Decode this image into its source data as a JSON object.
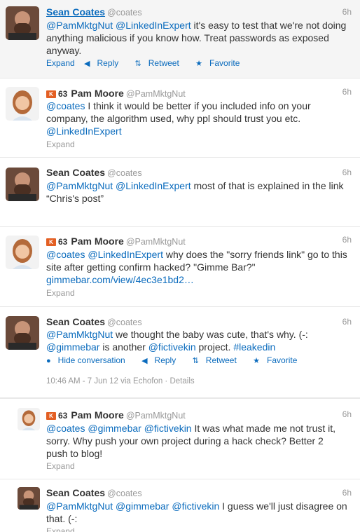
{
  "tweets": [
    {
      "name": "Sean Coates",
      "handle": "@coates",
      "time": "6h",
      "text_parts": [
        {
          "t": "@PamMktgNut",
          "m": true
        },
        {
          "t": " ",
          "m": false
        },
        {
          "t": "@LinkedInExpert",
          "m": true
        },
        {
          "t": " it's easy to test that we're not doing anything malicious if you know how. Treat passwords as exposed anyway.",
          "m": false
        }
      ],
      "actions": {
        "expand": "Expand",
        "reply": "Reply",
        "retweet": "Retweet",
        "favorite": "Favorite"
      }
    },
    {
      "name": "Pam Moore",
      "handle": "@PamMktgNut",
      "klout": "63",
      "time": "6h",
      "text_parts": [
        {
          "t": "@coates",
          "m": true
        },
        {
          "t": " I think it would be better if you included info on your company, the algorithm used, why ppl should trust you etc. ",
          "m": false
        },
        {
          "t": "@LinkedInExpert",
          "m": true
        }
      ],
      "expand": "Expand"
    },
    {
      "name": "Sean Coates",
      "handle": "@coates",
      "time": "6h",
      "text_parts": [
        {
          "t": "@PamMktgNut",
          "m": true
        },
        {
          "t": " ",
          "m": false
        },
        {
          "t": "@LinkedInExpert",
          "m": true
        },
        {
          "t": " most of that is explained in the link “Chris's post”",
          "m": false
        }
      ]
    },
    {
      "name": "Pam Moore",
      "handle": "@PamMktgNut",
      "klout": "63",
      "time": "6h",
      "text_parts": [
        {
          "t": "@coates",
          "m": true
        },
        {
          "t": " ",
          "m": false
        },
        {
          "t": "@LinkedInExpert",
          "m": true
        },
        {
          "t": " why does the \"sorry friends link\" go to this site after getting confirm hacked? \"Gimme Bar?\" ",
          "m": false
        },
        {
          "t": "gimmebar.com/view/4ec3e1bd2…",
          "m": true
        }
      ],
      "expand": "Expand"
    },
    {
      "name": "Sean Coates",
      "handle": "@coates",
      "time": "6h",
      "text_parts": [
        {
          "t": "@PamMktgNut",
          "m": true
        },
        {
          "t": " we thought the baby was cute, that's why. (-: ",
          "m": false
        },
        {
          "t": "@gimmebar",
          "m": true
        },
        {
          "t": " is another ",
          "m": false
        },
        {
          "t": "@fictivekin",
          "m": true
        },
        {
          "t": " project. ",
          "m": false
        },
        {
          "t": "#leakedin",
          "m": true
        }
      ],
      "actions": {
        "hide": "Hide conversation",
        "reply": "Reply",
        "retweet": "Retweet",
        "favorite": "Favorite"
      },
      "meta_time": "10:46 AM - 7 Jun 12 via Echofon",
      "meta_sep": "·",
      "meta_details": "Details"
    },
    {
      "name": "Pam Moore",
      "handle": "@PamMktgNut",
      "klout": "63",
      "time": "6h",
      "text_parts": [
        {
          "t": "@coates",
          "m": true
        },
        {
          "t": " ",
          "m": false
        },
        {
          "t": "@gimmebar",
          "m": true
        },
        {
          "t": " ",
          "m": false
        },
        {
          "t": "@fictivekin",
          "m": true
        },
        {
          "t": " It was what made me not trust it, sorry. Why push your own project during a hack check? Better 2 push to blog!",
          "m": false
        }
      ],
      "expand": "Expand"
    },
    {
      "name": "Sean Coates",
      "handle": "@coates",
      "time": "6h",
      "text_parts": [
        {
          "t": "@PamMktgNut",
          "m": true
        },
        {
          "t": " ",
          "m": false
        },
        {
          "t": "@gimmebar",
          "m": true
        },
        {
          "t": " ",
          "m": false
        },
        {
          "t": "@fictivekin",
          "m": true
        },
        {
          "t": " I guess we'll just disagree on that. (-:",
          "m": false
        }
      ],
      "expand": "Expand"
    }
  ]
}
